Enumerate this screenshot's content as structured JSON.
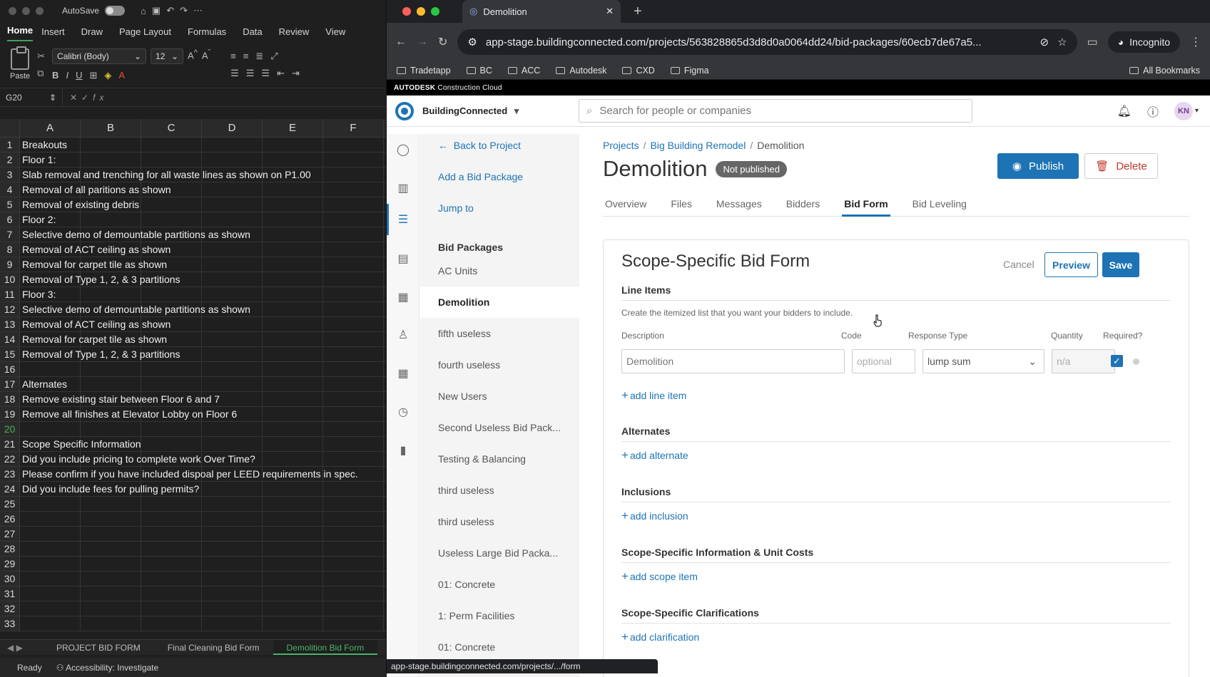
{
  "excel": {
    "autosave_label": "AutoSave",
    "tabs": [
      "Home",
      "Insert",
      "Draw",
      "Page Layout",
      "Formulas",
      "Data",
      "Review",
      "View"
    ],
    "active_tab": "Home",
    "paste_label": "Paste",
    "font_name": "Calibri (Body)",
    "font_size": "12",
    "name_box": "G20",
    "fx_symbol": "fx",
    "columns": [
      "A",
      "B",
      "C",
      "D",
      "E",
      "F"
    ],
    "selected_row": "20",
    "rows": [
      {
        "n": "1",
        "a": "Breakouts"
      },
      {
        "n": "2",
        "a": "Floor 1:"
      },
      {
        "n": "3",
        "a": "Slab removal and trenching for all waste lines as shown on P1.00"
      },
      {
        "n": "4",
        "a": "Removal of all paritions as shown"
      },
      {
        "n": "5",
        "a": "Removal of existing debris"
      },
      {
        "n": "6",
        "a": "Floor 2:"
      },
      {
        "n": "7",
        "a": "Selective demo of demountable partitions as shown"
      },
      {
        "n": "8",
        "a": "Removal of ACT ceiling as shown"
      },
      {
        "n": "9",
        "a": "Removal for carpet tile as shown"
      },
      {
        "n": "10",
        "a": "Removal of Type 1, 2, & 3 partitions"
      },
      {
        "n": "11",
        "a": "Floor 3:"
      },
      {
        "n": "12",
        "a": "Selective demo of demountable partitions as shown"
      },
      {
        "n": "13",
        "a": "Removal of ACT ceiling as shown"
      },
      {
        "n": "14",
        "a": "Removal for carpet tile as shown"
      },
      {
        "n": "15",
        "a": "Removal of Type 1, 2, & 3 partitions"
      },
      {
        "n": "16",
        "a": ""
      },
      {
        "n": "17",
        "a": "Alternates"
      },
      {
        "n": "18",
        "a": "Remove existing stair between Floor 6 and 7"
      },
      {
        "n": "19",
        "a": "Remove all finishes at Elevator Lobby on Floor 6"
      },
      {
        "n": "20",
        "a": ""
      },
      {
        "n": "21",
        "a": "Scope Specific Information"
      },
      {
        "n": "22",
        "a": "Did you include pricing to complete work Over Time?"
      },
      {
        "n": "23",
        "a": "Please confirm if you have included dispoal per LEED requirements in spec."
      },
      {
        "n": "24",
        "a": "Did you include fees for pulling permits?"
      },
      {
        "n": "25",
        "a": ""
      },
      {
        "n": "26",
        "a": ""
      },
      {
        "n": "27",
        "a": ""
      },
      {
        "n": "28",
        "a": ""
      },
      {
        "n": "29",
        "a": ""
      },
      {
        "n": "30",
        "a": ""
      },
      {
        "n": "31",
        "a": ""
      },
      {
        "n": "32",
        "a": ""
      },
      {
        "n": "33",
        "a": ""
      }
    ],
    "sheet_tabs": [
      "PROJECT BID FORM",
      "Final Cleaning Bid Form",
      "Demolition Bid Form"
    ],
    "active_sheet": "Demolition Bid Form",
    "status_ready": "Ready",
    "status_accessibility": "Accessibility: Investigate"
  },
  "browser": {
    "tab_title": "Demolition",
    "url": "app-stage.buildingconnected.com/projects/563828865d3d8d0a0064dd24/bid-packages/60ecb7de67a5...",
    "incognito_label": "Incognito",
    "bookmarks": [
      "Tradetapp",
      "BC",
      "ACC",
      "Autodesk",
      "CXD",
      "Figma"
    ],
    "all_bookmarks": "All Bookmarks",
    "status_url": "app-stage.buildingconnected.com/projects/.../form"
  },
  "app": {
    "brand_bar_bold": "AUTODESK",
    "brand_bar_rest": "Construction Cloud",
    "app_name": "BuildingConnected",
    "search_placeholder": "Search for people or companies",
    "avatar_initials": "KN",
    "sidebar": {
      "back": "Back to Project",
      "add_package": "Add a Bid Package",
      "jump_to": "Jump to",
      "heading": "Bid Packages",
      "items": [
        "AC Units",
        "Demolition",
        "fifth useless",
        "fourth useless",
        "New Users",
        "Second Useless Bid Pack...",
        "Testing & Balancing",
        "third useless",
        "third useless",
        "Useless Large Bid Packa...",
        "01: Concrete",
        "1: Perm Facilities",
        "01: Concrete"
      ],
      "active_item": "Demolition"
    },
    "breadcrumb": {
      "projects": "Projects",
      "project": "Big Building Remodel",
      "current": "Demolition"
    },
    "title": "Demolition",
    "status_badge": "Not published",
    "publish_label": "Publish",
    "delete_label": "Delete",
    "tabs": [
      "Overview",
      "Files",
      "Messages",
      "Bidders",
      "Bid Form",
      "Bid Leveling"
    ],
    "active_tab": "Bid Form",
    "form": {
      "title": "Scope-Specific Bid Form",
      "cancel": "Cancel",
      "preview": "Preview",
      "save": "Save",
      "line_items_heading": "Line Items",
      "line_items_desc": "Create the itemized list that you want your bidders to include.",
      "col_description": "Description",
      "col_code": "Code",
      "col_response": "Response Type",
      "col_quantity": "Quantity",
      "col_required": "Required?",
      "row_description": "Demolition",
      "code_placeholder": "optional",
      "response_type": "lump sum",
      "quantity_placeholder": "n/a",
      "required_checked": true,
      "add_line_item": "add line item",
      "alternates_heading": "Alternates",
      "add_alternate": "add alternate",
      "inclusions_heading": "Inclusions",
      "add_inclusion": "add inclusion",
      "scope_info_heading": "Scope-Specific Information & Unit Costs",
      "add_scope_item": "add scope item",
      "clarifications_heading": "Scope-Specific Clarifications",
      "add_clarification": "add clarification"
    }
  },
  "colors": {
    "accent": "#1e73b5",
    "excel_green": "#4bb36a",
    "danger": "#c0392b"
  }
}
